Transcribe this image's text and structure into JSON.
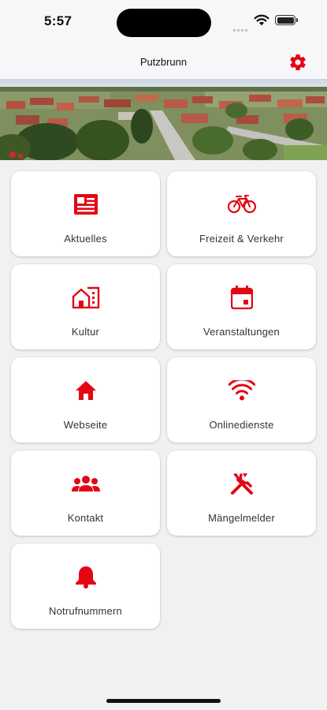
{
  "status_bar": {
    "time": "5:57"
  },
  "navbar": {
    "title": "Putzbrunn",
    "settings_icon": "gear-icon"
  },
  "colors": {
    "accent": "#e30613",
    "background": "#f1f1f4",
    "tile": "#ffffff"
  },
  "hero": {
    "image": "aerial photo of village"
  },
  "tiles": [
    {
      "label": "Aktuelles",
      "icon": "newspaper-icon"
    },
    {
      "label": "Freizeit & Verkehr",
      "icon": "bicycle-icon"
    },
    {
      "label": "Kultur",
      "icon": "buildings-icon"
    },
    {
      "label": "Veranstaltungen",
      "icon": "calendar-icon"
    },
    {
      "label": "Webseite",
      "icon": "home-icon"
    },
    {
      "label": "Onlinedienste",
      "icon": "wifi-icon"
    },
    {
      "label": "Kontakt",
      "icon": "group-icon"
    },
    {
      "label": "Mängelmelder",
      "icon": "tools-icon"
    },
    {
      "label": "Notrufnummern",
      "icon": "bell-icon"
    }
  ]
}
